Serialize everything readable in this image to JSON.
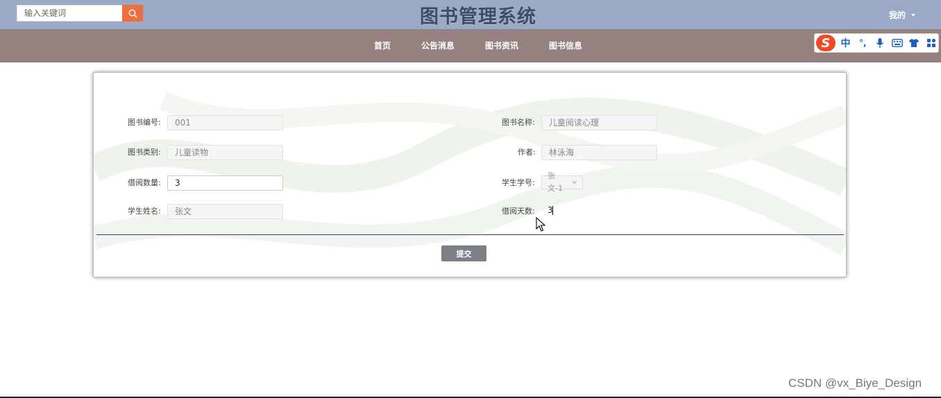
{
  "header": {
    "search": {
      "placeholder": "输入关键词",
      "button_icon": "search-icon"
    },
    "site_title": "图书管理系统",
    "user_menu": {
      "label": "我的",
      "icon": "caret-down-icon"
    }
  },
  "nav": {
    "items": [
      {
        "label": "首页"
      },
      {
        "label": "公告消息"
      },
      {
        "label": "图书资讯"
      },
      {
        "label": "图书信息"
      }
    ]
  },
  "ime_toolbar": {
    "logo": "S",
    "mode": "中",
    "punct": "°,",
    "icons": [
      "microphone-icon",
      "keyboard-icon",
      "shirt-icon",
      "grid-icon"
    ]
  },
  "form": {
    "book_no": {
      "label": "图书编号:",
      "value": "001"
    },
    "book_name": {
      "label": "图书名称:",
      "value": "儿童阅读心理"
    },
    "book_category": {
      "label": "图书类别:",
      "value": "儿童读物"
    },
    "author": {
      "label": "作者:",
      "value": "林泳海"
    },
    "borrow_count": {
      "label": "借阅数量:",
      "value": "3"
    },
    "student_no": {
      "label": "学生学号:",
      "value": "张文-1"
    },
    "student_name": {
      "label": "学生姓名:",
      "value": "张文"
    },
    "borrow_days": {
      "label": "借阅天数:",
      "value": "3"
    },
    "submit_label": "提交"
  },
  "watermark": "CSDN @vx_Biye_Design",
  "colors": {
    "header_bg": "#9aaac6",
    "nav_bg": "#958180",
    "search_button": "#ef6e3d",
    "title": "#3c4b6a",
    "submit_button": "#7d7f88"
  }
}
